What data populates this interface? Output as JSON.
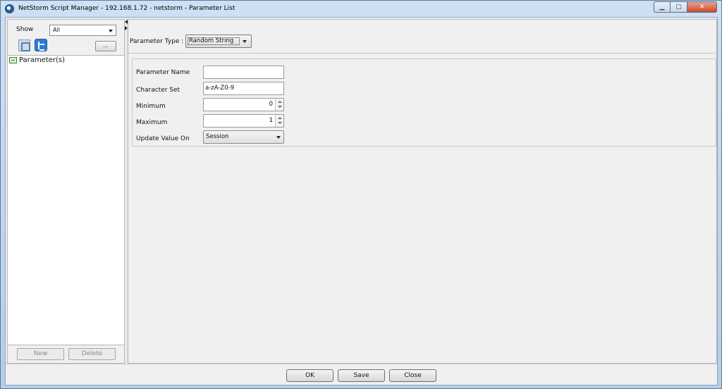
{
  "window": {
    "title": "NetStorm  Script Manager - 192.168.1.72 - netstorm - Parameter List",
    "controls": {
      "minimize": "▁",
      "maximize": "▢",
      "close": "✕"
    }
  },
  "left_panel": {
    "show_label": "Show",
    "show_value": "All",
    "more_label": "...",
    "tree": [
      {
        "label": "Parameter(s)"
      }
    ],
    "new_label": "New",
    "delete_label": "Delete"
  },
  "right_panel": {
    "parameter_type_label": "Parameter Type :",
    "parameter_type_value": "Random String",
    "fields": {
      "parameter_name": {
        "label": "Parameter Name",
        "value": ""
      },
      "character_set": {
        "label": "Character Set",
        "value": "a-zA-Z0-9"
      },
      "minimum": {
        "label": "Minimum",
        "value": "0"
      },
      "maximum": {
        "label": "Maximum",
        "value": "1"
      },
      "update_value_on": {
        "label": "Update Value On",
        "value": "Session"
      }
    }
  },
  "bottom": {
    "ok_label": "OK",
    "save_label": "Save",
    "close_label": "Close"
  }
}
